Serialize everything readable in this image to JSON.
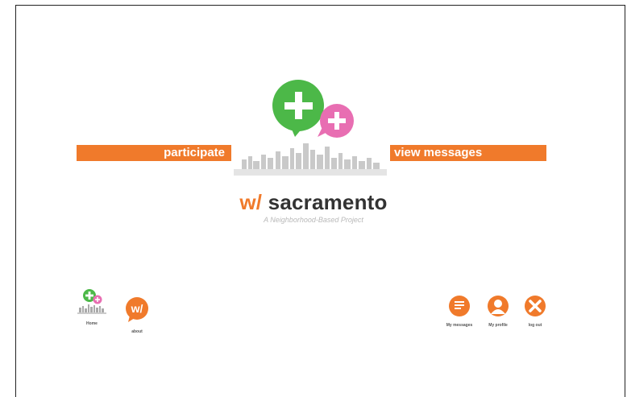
{
  "header": {
    "participate_label": "participate",
    "view_messages_label": "view messages"
  },
  "brand": {
    "prefix": "w/",
    "name": "sacramento",
    "tagline": "A Neighborhood-Based Project"
  },
  "nav_left": [
    {
      "label": "Home",
      "icon": "home-icon"
    },
    {
      "label": "about",
      "icon": "about-logo-icon"
    }
  ],
  "nav_right": [
    {
      "label": "My messages",
      "icon": "messages-icon"
    },
    {
      "label": "My profile",
      "icon": "profile-icon"
    },
    {
      "label": "log out",
      "icon": "close-icon"
    }
  ],
  "colors": {
    "accent_orange": "#f07a2b",
    "bubble_green": "#4cb848",
    "bubble_pink": "#e86eb2",
    "skyline_gray": "#c9c9c9"
  }
}
